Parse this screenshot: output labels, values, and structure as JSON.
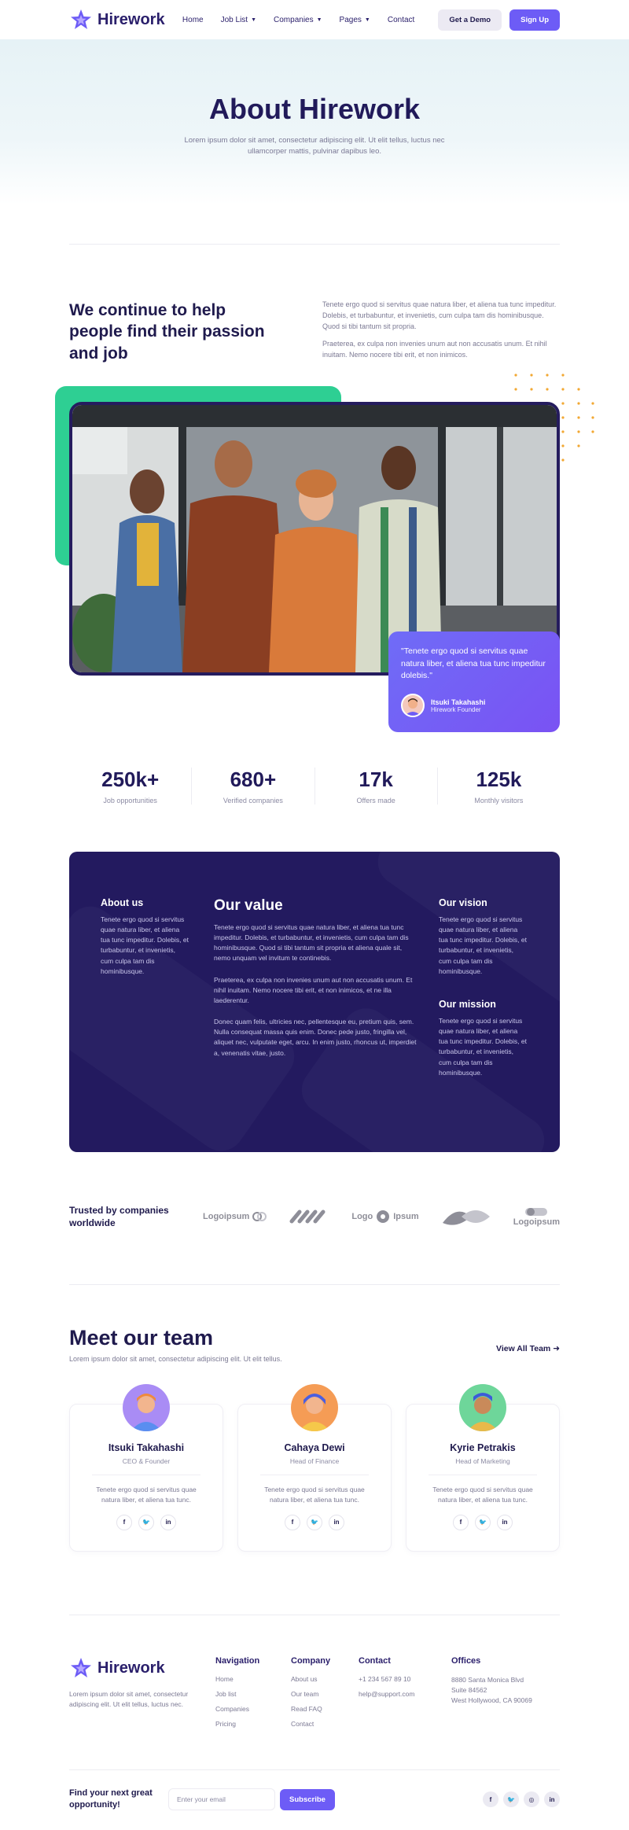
{
  "brand": {
    "name": "Hirework",
    "accent": "#6d5cf6",
    "navy": "#231a5f",
    "green": "#2ecf93"
  },
  "nav": {
    "items": [
      {
        "label": "Home"
      },
      {
        "label": "Job List"
      },
      {
        "label": "Companies"
      },
      {
        "label": "Pages"
      },
      {
        "label": "Contact"
      }
    ],
    "demo_label": "Get a Demo",
    "signup_label": "Sign Up"
  },
  "hero": {
    "title": "About Hirework",
    "subtitle": "Lorem ipsum dolor sit amet, consectetur adipiscing elit. Ut elit tellus, luctus nec ullamcorper mattis, pulvinar dapibus leo."
  },
  "intro": {
    "heading": "We continue to help people find their passion and job",
    "p1": "Tenete ergo quod si servitus quae natura liber, et aliena tua tunc impeditur. Dolebis, et turbabuntur, et invenietis, cum culpa tam dis hominibusque. Quod si tibi tantum sit propria.",
    "p2": "Praeterea, ex culpa non invenies unum aut non accusatis unum. Et nihil inuitam. Nemo nocere tibi erit, et non inimicos."
  },
  "quote": {
    "text": "\"Tenete ergo quod si servitus quae natura liber, et aliena tua tunc impeditur dolebis.\"",
    "name": "Itsuki Takahashi",
    "role": "Hirework Founder"
  },
  "stats": [
    {
      "value": "250k+",
      "label": "Job opportunities"
    },
    {
      "value": "680+",
      "label": "Verified companies"
    },
    {
      "value": "17k",
      "label": "Offers made"
    },
    {
      "value": "125k",
      "label": "Monthly visitors"
    }
  ],
  "values": {
    "about_title": "About us",
    "about_text": "Tenete ergo quod si servitus quae natura liber, et aliena tua tunc impeditur. Dolebis, et turbabuntur, et invenietis, cum culpa tam dis hominibusque.",
    "value_title": "Our value",
    "value_p1": "Tenete ergo quod si servitus quae natura liber, et aliena tua tunc impeditur. Dolebis, et turbabuntur, et invenietis, cum culpa tam dis hominibusque. Quod si tibi tantum sit propria et aliena quale sit, nemo unquam vel invitum te continebis.",
    "value_p2": "Praeterea, ex culpa non invenies unum aut non accusatis unum. Et nihil inuitam. Nemo nocere tibi erit, et non inimicos, et ne illa laederentur.",
    "value_p3": "Donec quam felis, ultricies nec, pellentesque eu, pretium quis, sem. Nulla consequat massa quis enim. Donec pede justo, fringilla vel, aliquet nec, vulputate eget, arcu. In enim justo, rhoncus ut, imperdiet a, venenatis vitae, justo.",
    "vision_title": "Our vision",
    "vision_text": "Tenete ergo quod si servitus quae natura liber, et aliena tua tunc impeditur. Dolebis, et turbabuntur, et invenietis, cum culpa tam dis hominibusque.",
    "mission_title": "Our mission",
    "mission_text": "Tenete ergo quod si servitus quae natura liber, et aliena tua tunc impeditur. Dolebis, et turbabuntur, et invenietis, cum culpa tam dis hominibusque."
  },
  "trusted": {
    "heading": "Trusted by companies worldwide",
    "logos": [
      "Logoipsum",
      "Logo",
      "Ipsum",
      "Logoipsum"
    ]
  },
  "team": {
    "heading": "Meet our team",
    "subtitle": "Lorem ipsum dolor sit amet, consectetur adipiscing elit. Ut elit tellus.",
    "view_all": "View All Team",
    "members": [
      {
        "name": "Itsuki Takahashi",
        "role": "CEO & Founder",
        "bio": "Tenete ergo quod si servitus quae natura liber, et aliena tua tunc.",
        "avatar_color": "#a98cf5"
      },
      {
        "name": "Cahaya Dewi",
        "role": "Head of Finance",
        "bio": "Tenete ergo quod si servitus quae natura liber, et aliena tua tunc.",
        "avatar_color": "#f59c55"
      },
      {
        "name": "Kyrie Petrakis",
        "role": "Head of Marketing",
        "bio": "Tenete ergo quod si servitus quae natura liber, et aliena tua tunc.",
        "avatar_color": "#6ed69a"
      }
    ]
  },
  "footer": {
    "about": "Lorem ipsum dolor sit amet, consectetur adipiscing elit. Ut elit tellus, luctus nec.",
    "navigation_title": "Navigation",
    "navigation": [
      "Home",
      "Job list",
      "Companies",
      "Pricing"
    ],
    "company_title": "Company",
    "company": [
      "About us",
      "Our team",
      "Read FAQ",
      "Contact"
    ],
    "contact_title": "Contact",
    "contact": [
      "+1 234 567 89 10",
      "help@support.com"
    ],
    "offices_title": "Offices",
    "offices": [
      "8880 Santa Monica Blvd",
      "Suite 84562",
      "West Hollywood, CA 90069"
    ]
  },
  "newsletter": {
    "heading": "Find your next great opportunity!",
    "placeholder": "Enter your email",
    "button": "Subscribe"
  }
}
